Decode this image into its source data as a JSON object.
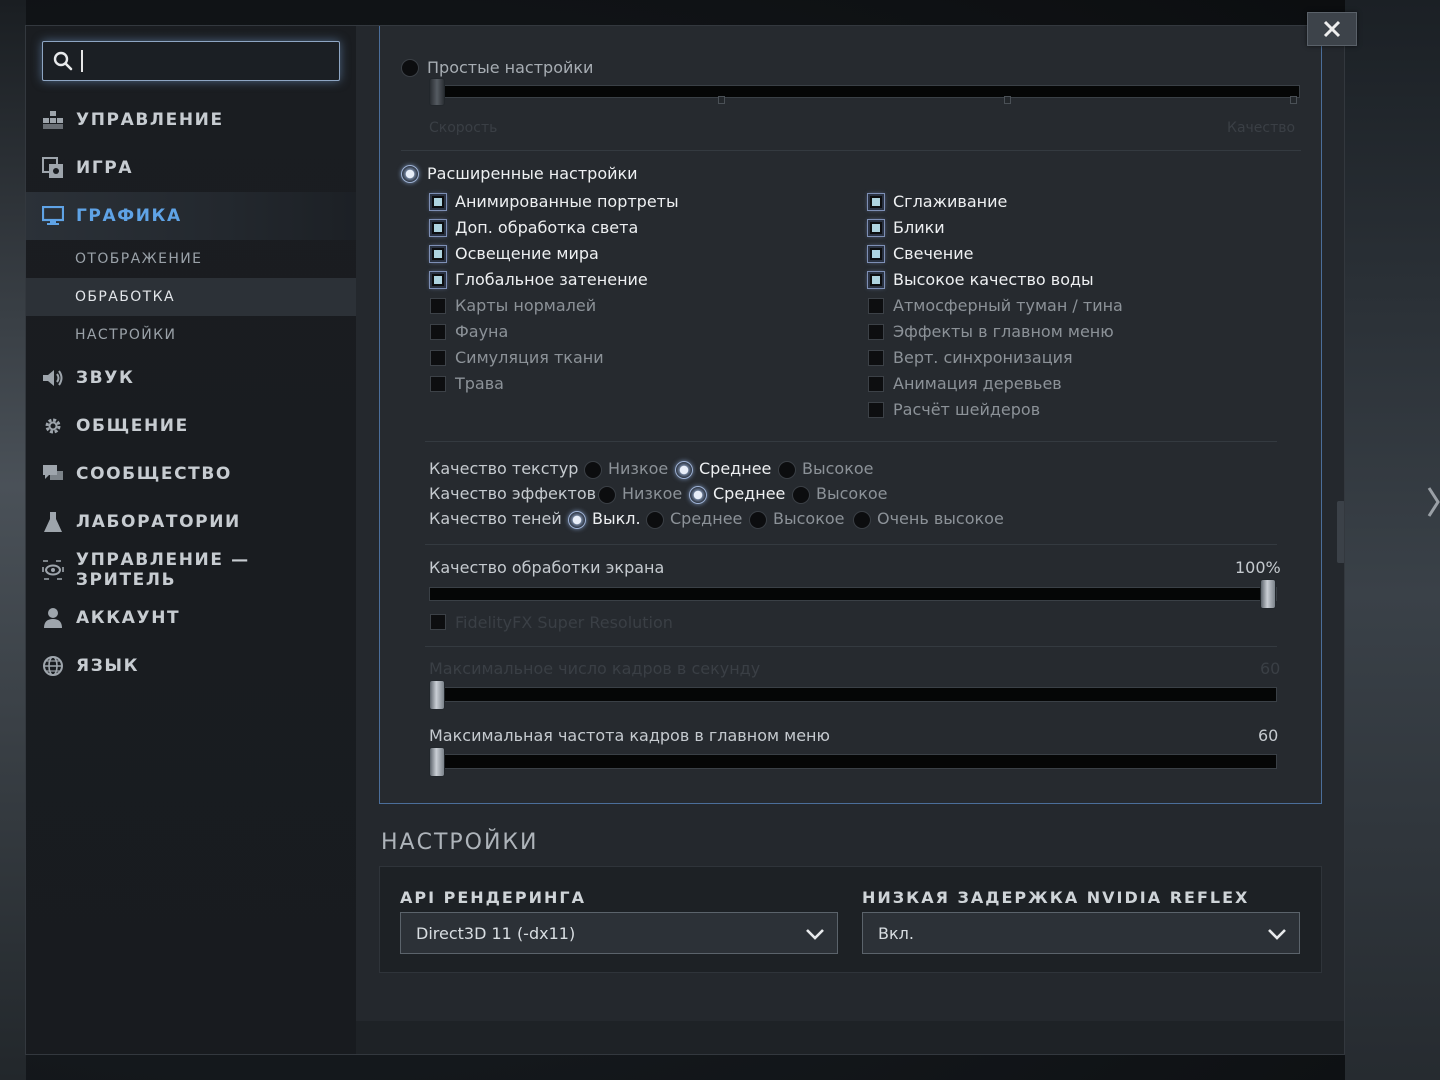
{
  "search": {
    "value": ""
  },
  "sidebar": {
    "items": [
      {
        "label": "УПРАВЛЕНИЕ",
        "icon": "controls-icon"
      },
      {
        "label": "ИГРА",
        "icon": "game-icon"
      },
      {
        "label": "ГРАФИКА",
        "icon": "monitor-icon",
        "active": true
      },
      {
        "label": "ЗВУК",
        "icon": "speaker-icon"
      },
      {
        "label": "ОБЩЕНИЕ",
        "icon": "gear-icon"
      },
      {
        "label": "СООБЩЕСТВО",
        "icon": "chat-icon"
      },
      {
        "label": "ЛАБОРАТОРИИ",
        "icon": "flask-icon"
      },
      {
        "label": "УПРАВЛЕНИЕ — ЗРИТЕЛЬ",
        "icon": "eye-icon"
      },
      {
        "label": "АККАУНТ",
        "icon": "user-icon"
      },
      {
        "label": "ЯЗЫК",
        "icon": "globe-icon"
      }
    ],
    "subitems": [
      {
        "label": "ОТОБРАЖЕНИЕ"
      },
      {
        "label": "ОБРАБОТКА",
        "active": true
      },
      {
        "label": "НАСТРОЙКИ"
      }
    ]
  },
  "graphics": {
    "simple_label": "Простые настройки",
    "speed_label": "Скорость",
    "quality_label": "Качество",
    "advanced_label": "Расширенные настройки",
    "left_checks": [
      {
        "label": "Анимированные портреты",
        "checked": true
      },
      {
        "label": "Доп. обработка света",
        "checked": true
      },
      {
        "label": "Освещение мира",
        "checked": true
      },
      {
        "label": "Глобальное затенение",
        "checked": true
      },
      {
        "label": "Карты нормалей",
        "checked": false
      },
      {
        "label": "Фауна",
        "checked": false
      },
      {
        "label": "Симуляция ткани",
        "checked": false
      },
      {
        "label": "Трава",
        "checked": false
      }
    ],
    "right_checks": [
      {
        "label": "Сглаживание",
        "checked": true
      },
      {
        "label": "Блики",
        "checked": true
      },
      {
        "label": "Свечение",
        "checked": true
      },
      {
        "label": "Высокое качество воды",
        "checked": true
      },
      {
        "label": "Атмосферный туман / тина",
        "checked": false
      },
      {
        "label": "Эффекты в главном меню",
        "checked": false
      },
      {
        "label": "Верт. синхронизация",
        "checked": false
      },
      {
        "label": "Анимация деревьев",
        "checked": false
      },
      {
        "label": "Расчёт шейдеров",
        "checked": false
      }
    ],
    "texture_quality": {
      "label": "Качество текстур",
      "options": [
        "Низкое",
        "Среднее",
        "Высокое"
      ],
      "selected": "Среднее"
    },
    "effects_quality": {
      "label": "Качество эффектов",
      "options": [
        "Низкое",
        "Среднее",
        "Высокое"
      ],
      "selected": "Среднее"
    },
    "shadow_quality": {
      "label": "Качество теней",
      "options": [
        "Выкл.",
        "Среднее",
        "Высокое",
        "Очень высокое"
      ],
      "selected": "Выкл."
    },
    "screen_quality": {
      "label": "Качество обработки экрана",
      "value_text": "100%",
      "value": 1.0
    },
    "fsr_label": "FidelityFX Super Resolution",
    "max_fps": {
      "label": "Максимальное число кадров в секунду",
      "value_text": "60",
      "value": 0.0
    },
    "menu_fps": {
      "label": "Максимальная частота кадров в главном меню",
      "value_text": "60",
      "value": 0.0
    }
  },
  "settings": {
    "title": "НАСТРОЙКИ",
    "api_label": "API РЕНДЕРИНГА",
    "api_value": "Direct3D 11 (-dx11)",
    "reflex_label": "НИЗКАЯ ЗАДЕРЖКА NVIDIA REFLEX",
    "reflex_value": "Вкл."
  },
  "colors": {
    "accent": "#5fa3e6",
    "panel_border": "#4b6e9a"
  }
}
